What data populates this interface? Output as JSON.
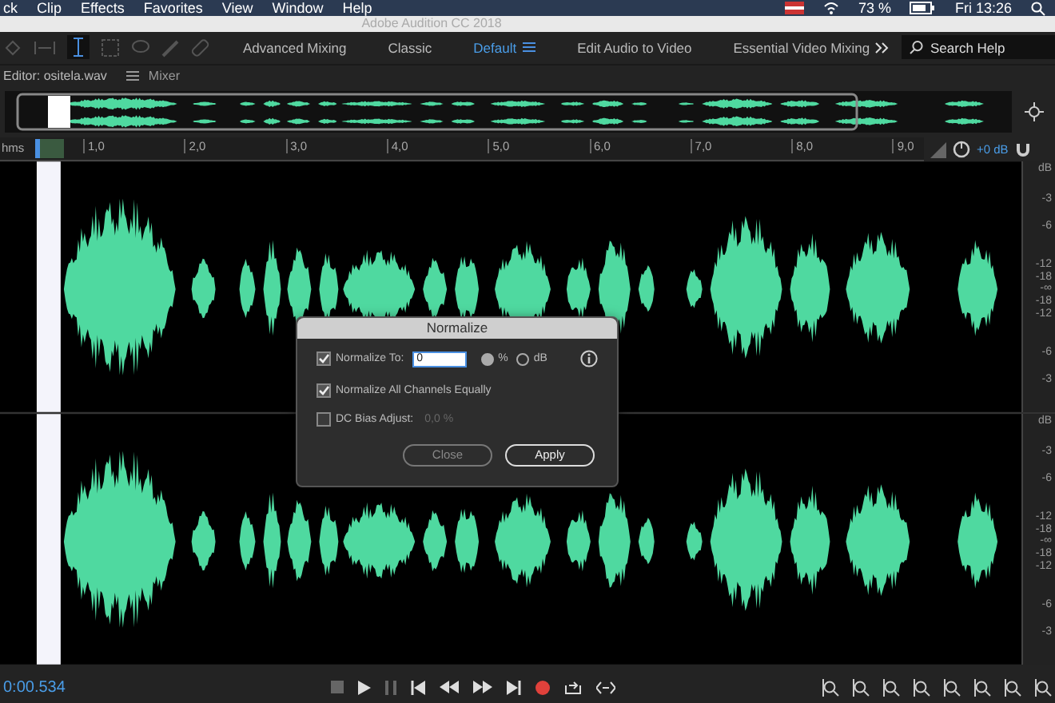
{
  "menu_bar": {
    "items": [
      "ck",
      "Clip",
      "Effects",
      "Favorites",
      "View",
      "Window",
      "Help"
    ],
    "battery": "73 %",
    "clock": "Fri 13:26"
  },
  "window": {
    "title": "Adobe Audition CC 2018"
  },
  "workspaces": [
    {
      "label": "Advanced Mixing",
      "selected": false
    },
    {
      "label": "Classic",
      "selected": false
    },
    {
      "label": "Default",
      "selected": true
    },
    {
      "label": "Edit Audio to Video",
      "selected": false
    },
    {
      "label": "Essential Video Mixing",
      "selected": false
    }
  ],
  "search": {
    "placeholder": "Search Help"
  },
  "panel_tabs": [
    {
      "label": "Editor: ositela.wav",
      "selected": true
    },
    {
      "label": "Mixer",
      "selected": false
    }
  ],
  "ruler": {
    "unit": "hms",
    "ticks": [
      "1,0",
      "2,0",
      "3,0",
      "4,0",
      "5,0",
      "6,0",
      "7,0",
      "8,0",
      "9,0"
    ],
    "gain": "+0 dB"
  },
  "channels": [
    {
      "scale": [
        "dB",
        "-3",
        "-6",
        "-12",
        "-18",
        "-∞",
        "-18",
        "-12",
        "-6",
        "-3"
      ]
    },
    {
      "scale": [
        "dB",
        "-3",
        "-6",
        "-12",
        "-18",
        "-∞",
        "-18",
        "-12",
        "-6",
        "-3"
      ]
    }
  ],
  "dialog": {
    "title": "Normalize",
    "normalize_to": {
      "label": "Normalize To:",
      "checked": true,
      "value": "0"
    },
    "units": [
      {
        "label": "%",
        "selected": true
      },
      {
        "label": "dB",
        "selected": false
      }
    ],
    "all_channels": {
      "label": "Normalize All Channels Equally",
      "checked": true
    },
    "dc_bias": {
      "label": "DC Bias Adjust:",
      "checked": false,
      "disabled": true,
      "value": "0,0 %"
    },
    "buttons": [
      {
        "label": "Close",
        "kind": "secondary"
      },
      {
        "label": "Apply",
        "kind": "primary"
      }
    ]
  },
  "transport": {
    "time": "0:00.534"
  }
}
